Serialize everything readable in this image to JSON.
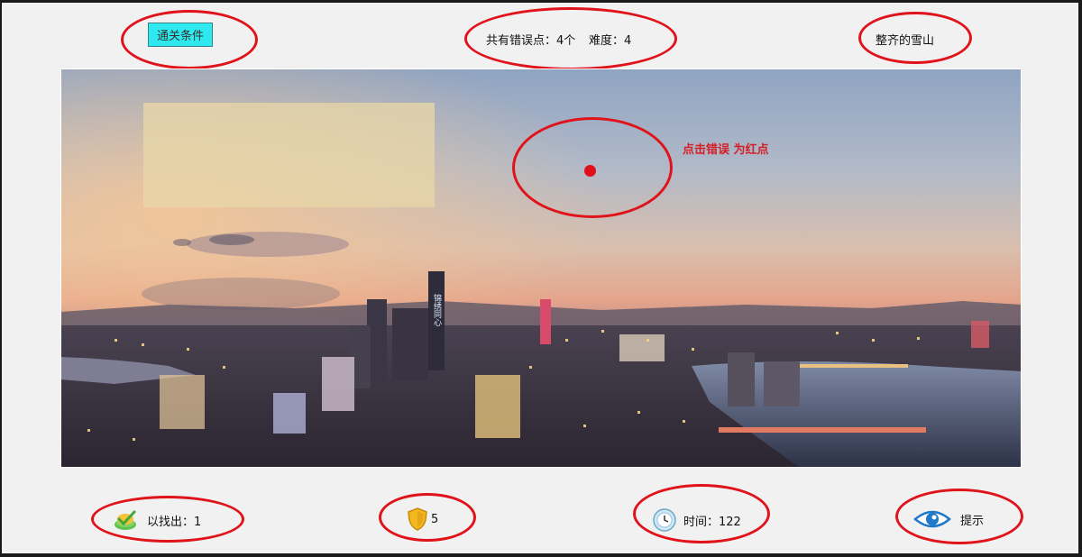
{
  "top_bar": {
    "pass_button_label": "通关条件",
    "error_count_text": "共有错误点：4个",
    "difficulty_text": "难度：4",
    "puzzle_title": "整齐的雪山"
  },
  "scene": {
    "annotation_text": "点击错误 为红点",
    "billboard_text": "锦绣同心"
  },
  "bottom_bar": {
    "found_text": "以找出：1",
    "shield_value": "5",
    "time_text": "时间：122",
    "hint_label": "提示"
  },
  "colors": {
    "annotation_red": "#e0131b",
    "pass_button_bg": "#2ee9ef",
    "page_bg": "#f1f1f1"
  },
  "icons": [
    "check-badge-icon",
    "shield-icon",
    "clock-icon",
    "eye-icon"
  ]
}
